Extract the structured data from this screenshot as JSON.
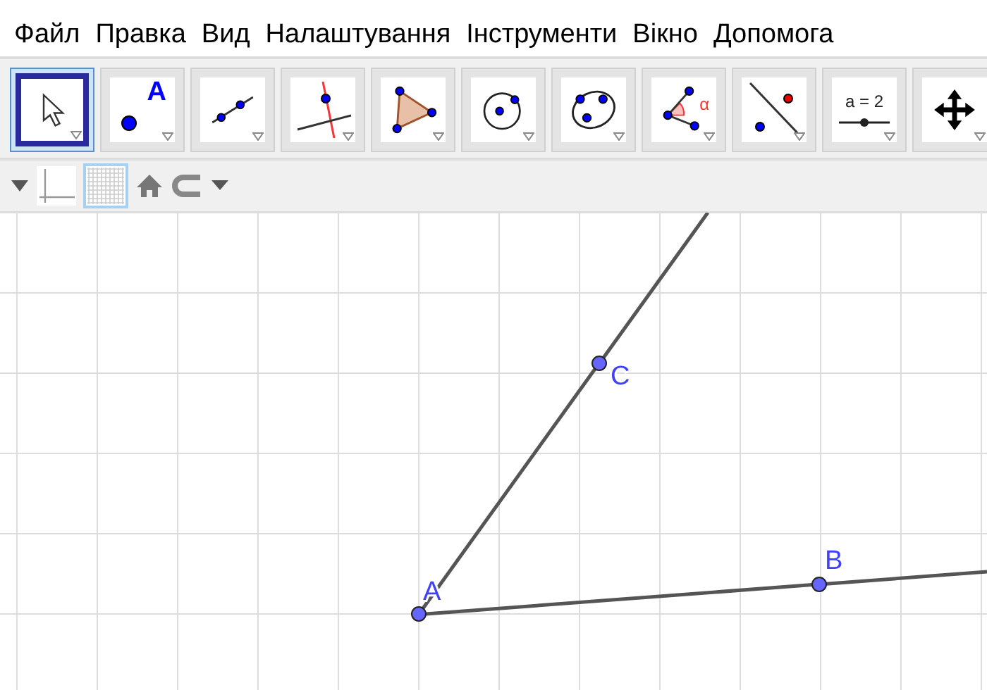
{
  "menu": [
    "Файл",
    "Правка",
    "Вид",
    "Налаштування",
    "Інструменти",
    "Вікно",
    "Допомога"
  ],
  "tools": [
    {
      "kind": "move",
      "selected": true
    },
    {
      "kind": "point",
      "selected": false,
      "text": "A"
    },
    {
      "kind": "line",
      "selected": false
    },
    {
      "kind": "perpendicular",
      "selected": false
    },
    {
      "kind": "polygon",
      "selected": false
    },
    {
      "kind": "circle",
      "selected": false
    },
    {
      "kind": "conic",
      "selected": false
    },
    {
      "kind": "angle",
      "selected": false,
      "text": "α"
    },
    {
      "kind": "reflect",
      "selected": false
    },
    {
      "kind": "slider",
      "selected": false,
      "text": "a = 2"
    },
    {
      "kind": "pan",
      "selected": false
    }
  ],
  "style_bar": [
    {
      "kind": "menu-toggle",
      "selected": false
    },
    {
      "kind": "axes",
      "selected": false
    },
    {
      "kind": "grid",
      "selected": true
    },
    {
      "kind": "home",
      "selected": false
    },
    {
      "kind": "capture",
      "selected": false
    }
  ],
  "points": [
    {
      "label": "A"
    },
    {
      "label": "C"
    },
    {
      "label": "B"
    }
  ]
}
